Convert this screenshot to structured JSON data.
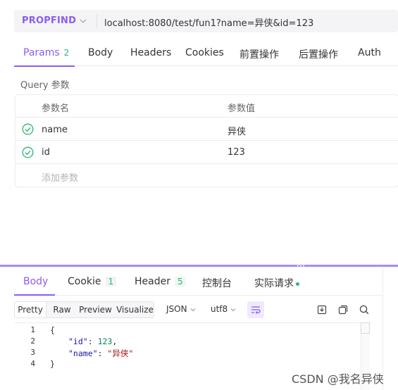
{
  "request": {
    "method": "PROPFIND",
    "url": "localhost:8080/test/fun1?name=异侠&id=123"
  },
  "request_tabs": [
    {
      "label": "Params",
      "count": "2"
    },
    {
      "label": "Body"
    },
    {
      "label": "Headers"
    },
    {
      "label": "Cookies"
    },
    {
      "label": "前置操作"
    },
    {
      "label": "后置操作"
    },
    {
      "label": "Auth"
    }
  ],
  "query": {
    "section_label": "Query 参数",
    "header_name": "参数名",
    "header_value": "参数值",
    "rows": [
      {
        "name": "name",
        "value": "异侠",
        "enabled": true
      },
      {
        "name": "id",
        "value": "123",
        "enabled": true
      }
    ],
    "add_placeholder": "添加参数"
  },
  "response_tabs": [
    {
      "label": "Body"
    },
    {
      "label": "Cookie",
      "count": "1"
    },
    {
      "label": "Header",
      "count": "5"
    },
    {
      "label": "控制台"
    },
    {
      "label": "实际请求"
    }
  ],
  "toolbar": {
    "views": [
      "Pretty",
      "Raw",
      "Preview",
      "Visualize"
    ],
    "format": "JSON",
    "encoding": "utf8"
  },
  "editor": {
    "line_numbers": [
      "1",
      "2",
      "3",
      "4"
    ],
    "lines": {
      "l1": "{",
      "l2_key": "\"id\"",
      "l2_sep": ": ",
      "l2_val": "123",
      "l2_end": ",",
      "l3_key": "\"name\"",
      "l3_sep": ": ",
      "l3_val": "\"异侠\"",
      "l4": "}"
    }
  },
  "watermark": "CSDN @我名异侠",
  "colors": {
    "accent": "#8a5cf6",
    "success": "#2bb673"
  }
}
